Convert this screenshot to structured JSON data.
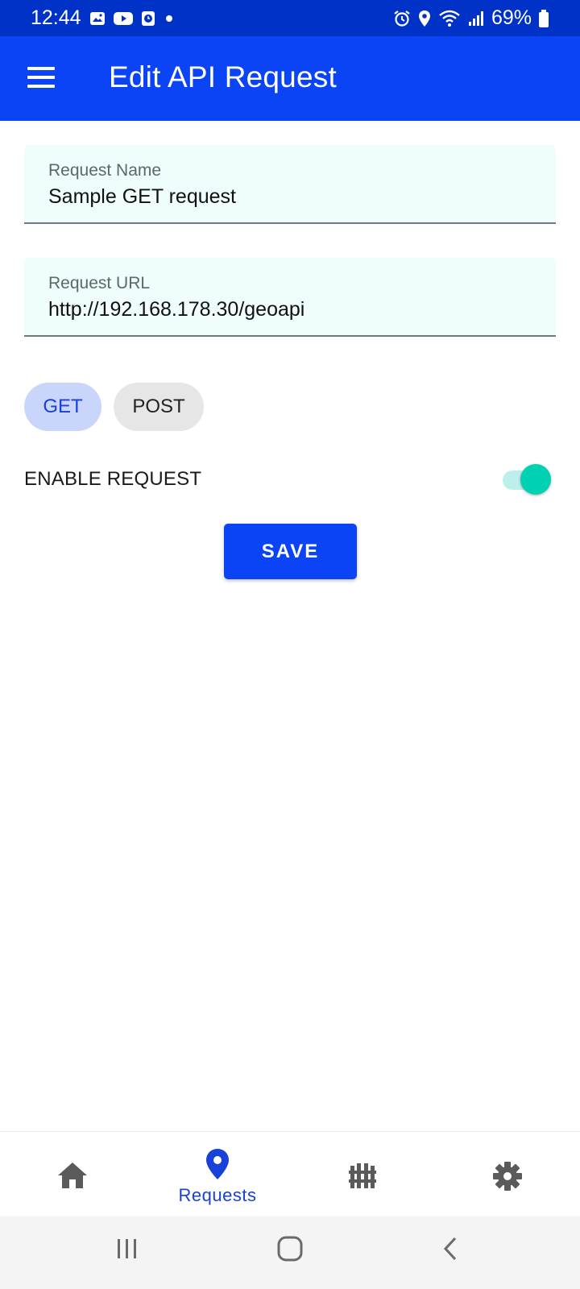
{
  "status_bar": {
    "time": "12:44",
    "battery_percent": "69%",
    "left_icons": [
      "gallery-icon",
      "youtube-icon",
      "clock-app-icon",
      "dot-icon"
    ],
    "right_icons": [
      "alarm-icon",
      "location-icon",
      "wifi-icon",
      "signal-icon",
      "battery-icon"
    ]
  },
  "app_bar": {
    "title": "Edit API Request",
    "menu_icon": "hamburger-menu-icon"
  },
  "form": {
    "request_name": {
      "label": "Request Name",
      "value": "Sample GET request"
    },
    "request_url": {
      "label": "Request URL",
      "value": "http://192.168.178.30/geoapi"
    },
    "methods": [
      {
        "label": "GET",
        "selected": true
      },
      {
        "label": "POST",
        "selected": false
      }
    ],
    "enable": {
      "label": "ENABLE REQUEST",
      "on": true
    },
    "save_label": "SAVE"
  },
  "bottom_nav": {
    "items": [
      {
        "icon": "home-icon",
        "label": "",
        "active": false
      },
      {
        "icon": "location-pin-icon",
        "label": "Requests",
        "active": true
      },
      {
        "icon": "fence-icon",
        "label": "",
        "active": false
      },
      {
        "icon": "gear-icon",
        "label": "",
        "active": false
      }
    ]
  },
  "system_nav": [
    "recents-button",
    "home-button",
    "back-button"
  ],
  "colors": {
    "status_bar": "#0032c8",
    "primary": "#0a44f5",
    "accent_toggle": "#00d1b2",
    "field_bg": "#f0fdfd",
    "chip_selected": "#c9d5fb",
    "chip_unselected": "#e6e6e6",
    "nav_active": "#1741d9",
    "nav_inactive": "#5a5a5a"
  }
}
